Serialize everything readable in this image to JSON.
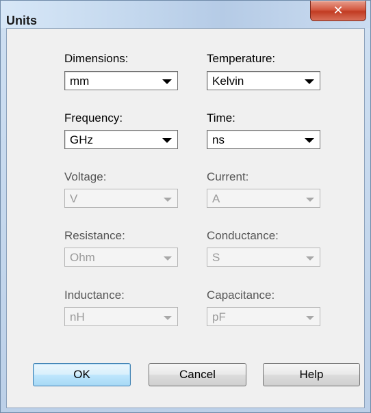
{
  "window": {
    "title": "Units",
    "close_glyph": "✕"
  },
  "fields": {
    "dimensions": {
      "label": "Dimensions:",
      "value": "mm",
      "enabled": true
    },
    "temperature": {
      "label": "Temperature:",
      "value": "Kelvin",
      "enabled": true
    },
    "frequency": {
      "label": "Frequency:",
      "value": "GHz",
      "enabled": true
    },
    "time": {
      "label": "Time:",
      "value": "ns",
      "enabled": true
    },
    "voltage": {
      "label": "Voltage:",
      "value": "V",
      "enabled": false
    },
    "current": {
      "label": "Current:",
      "value": "A",
      "enabled": false
    },
    "resistance": {
      "label": "Resistance:",
      "value": "Ohm",
      "enabled": false
    },
    "conductance": {
      "label": "Conductance:",
      "value": "S",
      "enabled": false
    },
    "inductance": {
      "label": "Inductance:",
      "value": "nH",
      "enabled": false
    },
    "capacitance": {
      "label": "Capacitance:",
      "value": "pF",
      "enabled": false
    }
  },
  "buttons": {
    "ok": "OK",
    "cancel": "Cancel",
    "help": "Help"
  },
  "colors": {
    "close_button": "#c13b22",
    "default_button_border": "#3c7fb1"
  },
  "icons": {
    "close": "close-icon",
    "dropdown": "chevron-down-icon"
  }
}
